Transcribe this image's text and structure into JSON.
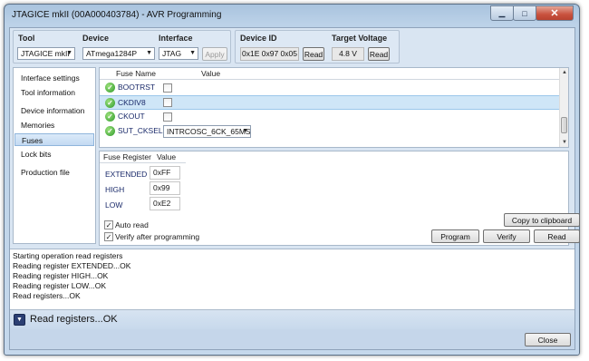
{
  "window": {
    "title": "JTAGICE mkII (00A000403784) - AVR Programming"
  },
  "header": {
    "tool_label": "Tool",
    "tool_value": "JTAGICE mkII",
    "device_label": "Device",
    "device_value": "ATmega1284P",
    "interface_label": "Interface",
    "interface_value": "JTAG",
    "apply_label": "Apply",
    "device_id_label": "Device ID",
    "device_id_value": "0x1E 0x97 0x05",
    "device_id_read": "Read",
    "voltage_label": "Target Voltage",
    "voltage_value": "4.8 V",
    "voltage_read": "Read"
  },
  "nav": {
    "items": [
      {
        "label": "Interface settings"
      },
      {
        "label": "Tool information"
      },
      {
        "label": "Device information"
      },
      {
        "label": "Memories"
      },
      {
        "label": "Fuses"
      },
      {
        "label": "Lock bits"
      },
      {
        "label": "Production file"
      }
    ],
    "active_index": 4
  },
  "fuses": {
    "col_name": "Fuse Name",
    "col_value": "Value",
    "rows": [
      {
        "name": "BOOTRST",
        "checked": false
      },
      {
        "name": "CKDIV8",
        "checked": false,
        "selected": true
      },
      {
        "name": "CKOUT",
        "checked": false
      },
      {
        "name": "SUT_CKSEL",
        "select_value": "INTRCOSC_6CK_65MS"
      }
    ]
  },
  "registers": {
    "col_register": "Fuse Register",
    "col_value": "Value",
    "rows": [
      {
        "name": "EXTENDED",
        "value": "0xFF"
      },
      {
        "name": "HIGH",
        "value": "0x99"
      },
      {
        "name": "LOW",
        "value": "0xE2"
      }
    ]
  },
  "options": {
    "auto_read": "Auto read",
    "verify_after": "Verify after programming"
  },
  "buttons": {
    "copy": "Copy to clipboard",
    "program": "Program",
    "verify": "Verify",
    "read": "Read",
    "close": "Close"
  },
  "log": {
    "lines": [
      "Starting operation read registers",
      "Reading register EXTENDED...OK",
      "Reading register HIGH...OK",
      "Reading register LOW...OK",
      "Read registers...OK"
    ]
  },
  "status": {
    "text": "Read registers...OK"
  },
  "colors": {
    "accent": "#2b3f73",
    "selected_row": "#cfe6f7",
    "ok_green": "#2e9a2b"
  }
}
